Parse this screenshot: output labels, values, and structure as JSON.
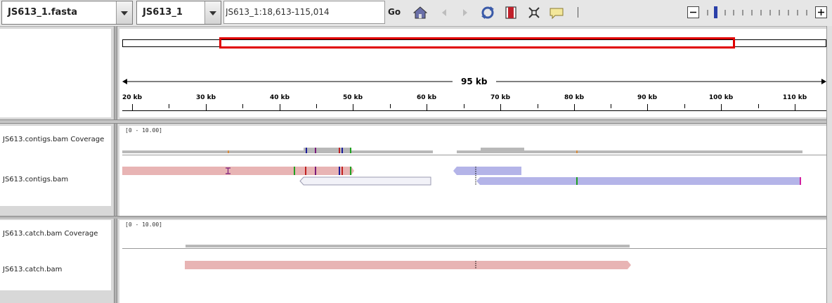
{
  "toolbar": {
    "genome_select": "JS613_1.fasta",
    "chromosome_select": "JS613_1",
    "locus": "JS613_1:18,613-115,014",
    "go_label": "Go"
  },
  "ruler": {
    "span_label": "95 kb",
    "ticks": [
      "20 kb",
      "30 kb",
      "40 kb",
      "50 kb",
      "60 kb",
      "70 kb",
      "80 kb",
      "90 kb",
      "100 kb",
      "110 kb"
    ]
  },
  "tracks": {
    "contigs_coverage_label": "JS613.contigs.bam Coverage",
    "contigs_coverage_range": "[0 - 10.00]",
    "contigs_bam_label": "JS613.contigs.bam",
    "catch_coverage_label": "JS613.catch.bam Coverage",
    "catch_coverage_range": "[0 - 10.00]",
    "catch_bam_label": "JS613.catch.bam"
  },
  "colors": {
    "forward_read": "#e8b4b4",
    "reverse_read": "#b4b4e8",
    "unpaired_read": "#f2f2f8",
    "coverage": "#b8b8b8",
    "viewport_box": "#e00000"
  }
}
